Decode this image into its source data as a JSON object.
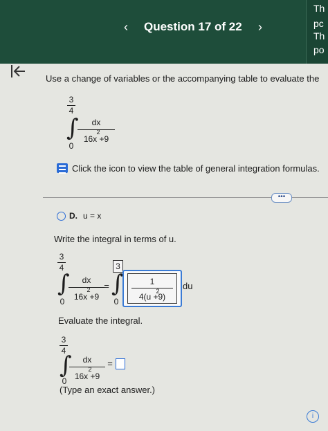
{
  "header": {
    "prev_label": "‹",
    "question_title": "Question 17 of 22",
    "next_label": "›",
    "side_lines": [
      "Th",
      "pc",
      "Th",
      "po"
    ]
  },
  "back_icon": "collapse-left-icon",
  "problem": {
    "prompt": "Use a change of variables or the accompanying table to evaluate the",
    "integral": {
      "upper_num": "3",
      "upper_den": "4",
      "lower": "0",
      "numerator": "dx",
      "denominator": "16x  +9",
      "exponent": "2"
    },
    "table_link": "Click the icon to view the table of general integration formulas."
  },
  "more_button": "•••",
  "option": {
    "letter": "D.",
    "text": "u = x"
  },
  "step1": {
    "instruction": "Write the integral in terms of u.",
    "left_upper_num": "3",
    "left_upper_den": "4",
    "left_lower": "0",
    "left_num": "dx",
    "left_den": "16x  +9",
    "left_exp": "2",
    "equals": "=",
    "right_upper": "3",
    "right_lower": "0",
    "right_num": "1",
    "right_den": "4(u  +9)",
    "right_exp": "2",
    "du": "du"
  },
  "step2": {
    "instruction": "Evaluate the integral.",
    "upper_num": "3",
    "upper_den": "4",
    "lower": "0",
    "numerator": "dx",
    "denominator": "16x  +9",
    "exponent": "2",
    "equals": "=",
    "hint": "(Type an exact answer.)"
  },
  "help_icon": "help-icon"
}
